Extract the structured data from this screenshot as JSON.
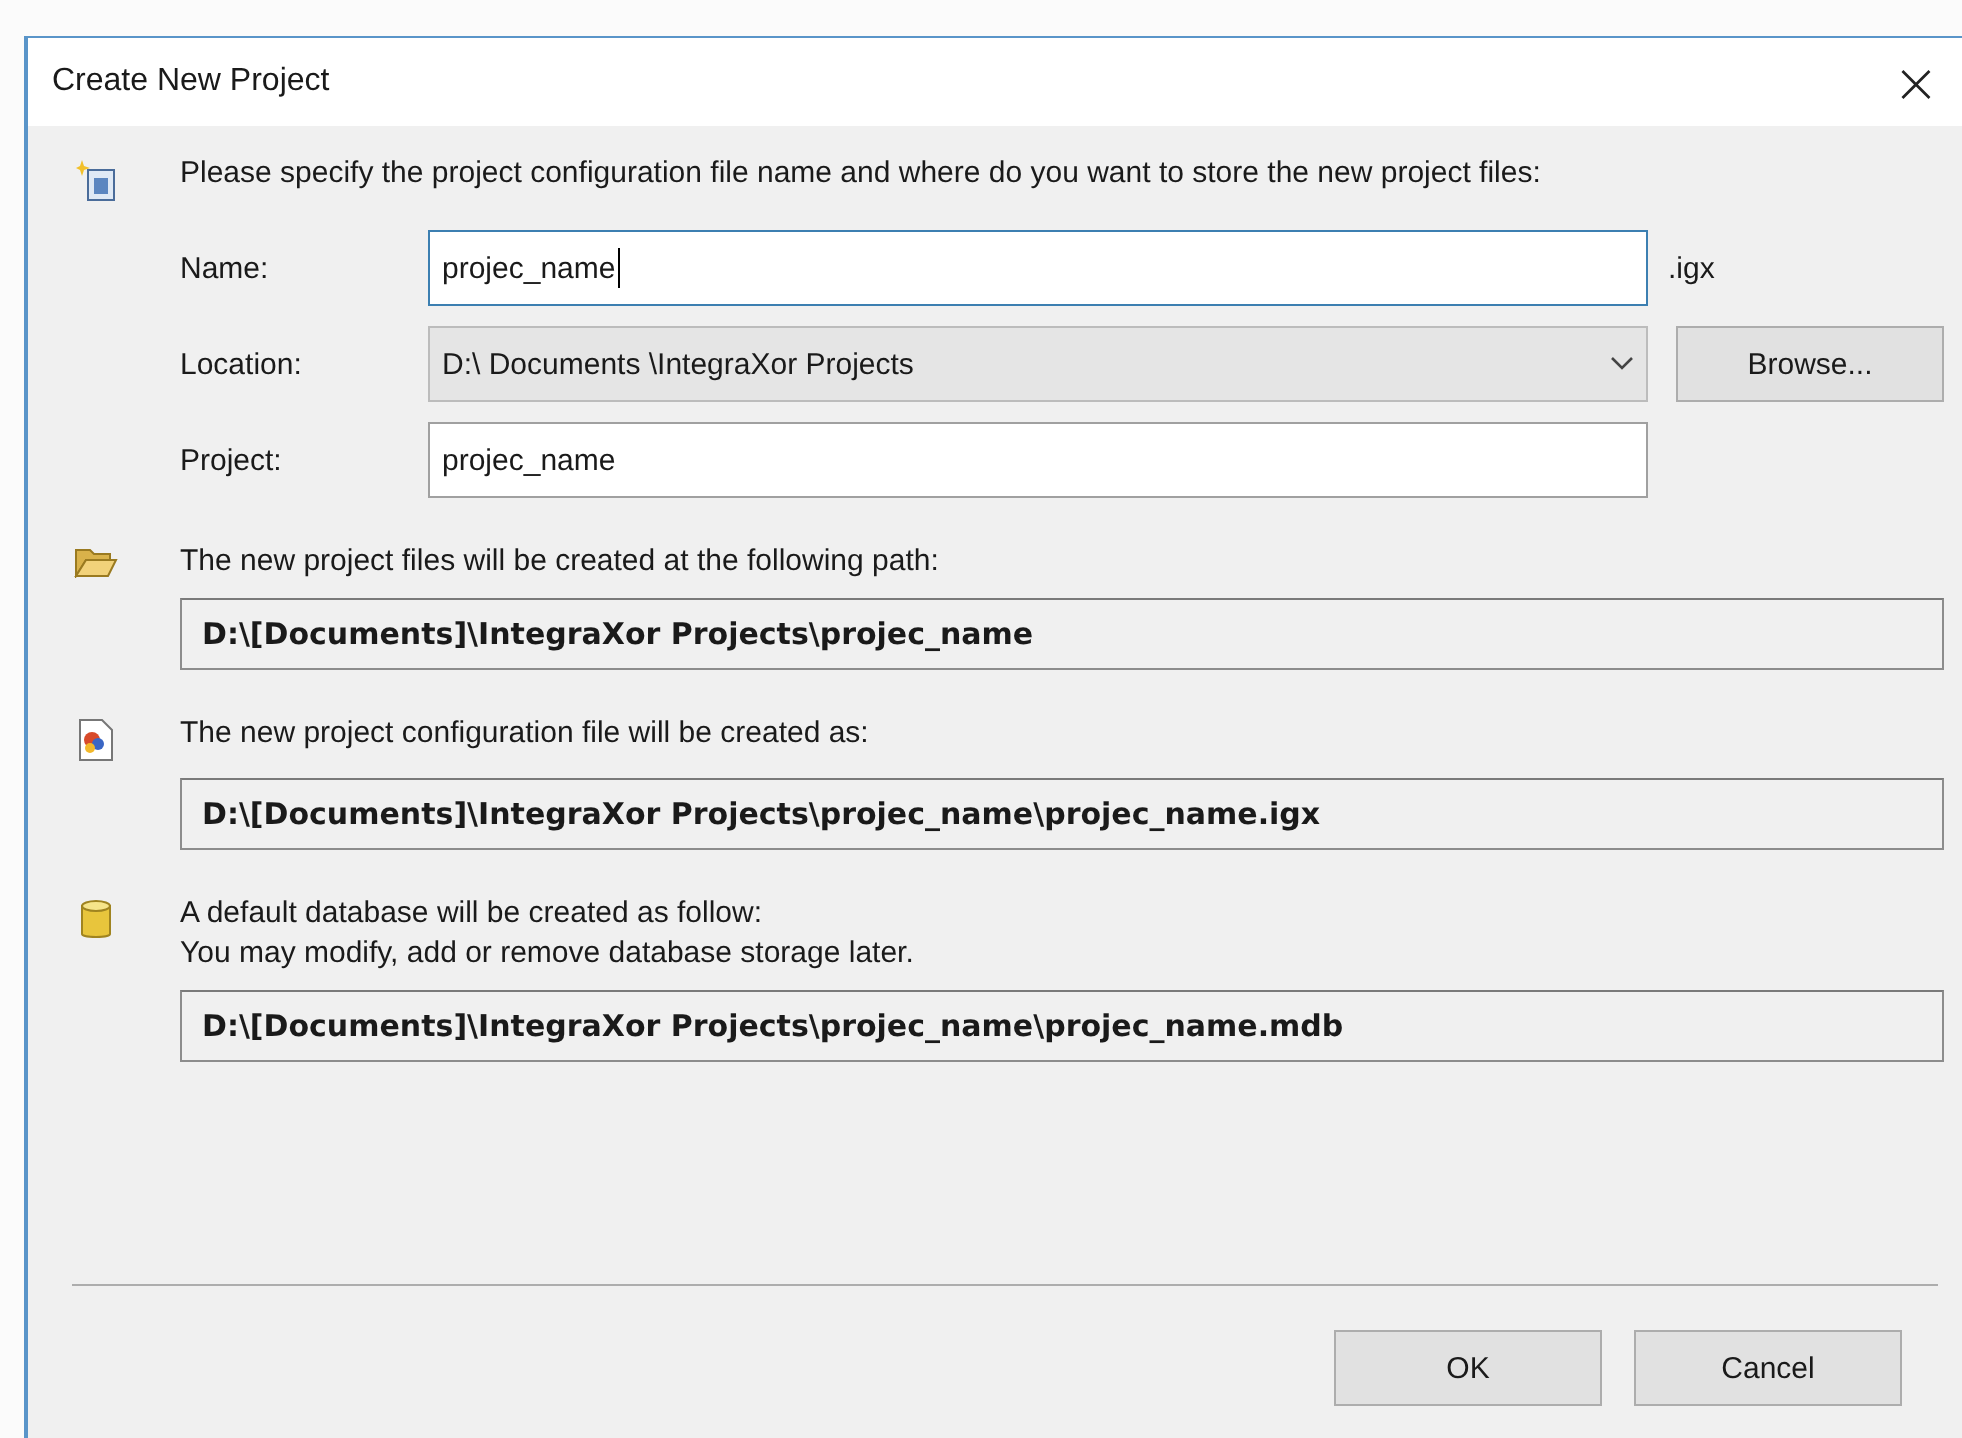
{
  "window": {
    "title": "Create New Project",
    "close": "×"
  },
  "intro": "Please specify the project configuration file name and where do you want to store the new project files:",
  "fields": [
    {
      "kind": "text",
      "label": "Name:",
      "value": "projec_name",
      "focused": true,
      "suffix": ".igx"
    },
    {
      "kind": "dropdown",
      "label": "Location:",
      "value": "D:\\ Documents  \\IntegraXor Projects",
      "button": "Browse..."
    },
    {
      "kind": "text",
      "label": "Project:",
      "value": "projec_name",
      "focused": false
    }
  ],
  "info": [
    {
      "kind": "folder",
      "lines": [
        "The new project files will be created at the following path:"
      ],
      "path": "D:\\[Documents]\\IntegraXor Projects\\projec_name"
    },
    {
      "kind": "config",
      "lines": [
        "The new project configuration file will be created as:"
      ],
      "path": "D:\\[Documents]\\IntegraXor Projects\\projec_name\\projec_name.igx"
    },
    {
      "kind": "database",
      "lines": [
        "A default database will be created as follow:",
        "You may modify, add or remove database storage later."
      ],
      "path": "D:\\[Documents]\\IntegraXor Projects\\projec_name\\projec_name.mdb"
    }
  ],
  "buttons": [
    "OK",
    "Cancel"
  ]
}
